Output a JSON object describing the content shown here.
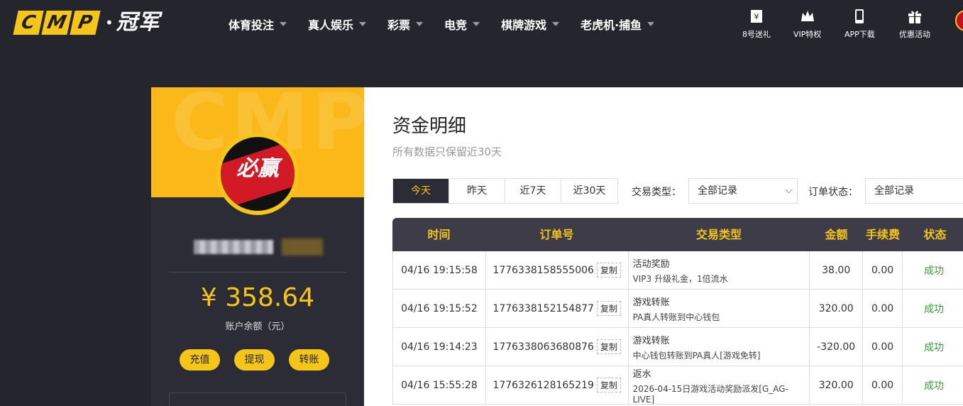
{
  "header": {
    "logo_letters": [
      "C",
      "M",
      "P"
    ],
    "logo_cn": "冠军",
    "nav": [
      {
        "label": "体育投注"
      },
      {
        "label": "真人娱乐"
      },
      {
        "label": "彩票"
      },
      {
        "label": "电竞"
      },
      {
        "label": "棋牌游戏"
      },
      {
        "label": "老虎机·捕鱼"
      }
    ],
    "quick_links": [
      {
        "label": "8号送礼",
        "icon": "gift-box-icon"
      },
      {
        "label": "VIP特权",
        "icon": "crown-icon"
      },
      {
        "label": "APP下载",
        "icon": "phone-icon"
      },
      {
        "label": "优惠活动",
        "icon": "present-icon"
      }
    ]
  },
  "profile": {
    "bg_text": "CMP",
    "avatar_text": "必赢",
    "balance": "¥ 358.64",
    "balance_label": "账户余额（元）",
    "buttons": {
      "deposit": "充值",
      "withdraw": "提现",
      "transfer": "转账"
    }
  },
  "main": {
    "title": "资金明细",
    "subtitle": "所有数据只保留近30天",
    "tabs": [
      {
        "label": "今天",
        "active": true
      },
      {
        "label": "昨天",
        "active": false
      },
      {
        "label": "近7天",
        "active": false
      },
      {
        "label": "近30天",
        "active": false
      }
    ],
    "filters": {
      "type_label": "交易类型：",
      "type_value": "全部记录",
      "status_label": "订单状态：",
      "status_value": "全部记录"
    },
    "table": {
      "headers": [
        "时间",
        "订单号",
        "交易类型",
        "金额",
        "手续费",
        "状态"
      ],
      "copy_label": "复制",
      "rows": [
        {
          "time": "04/16 19:15:58",
          "order": "1776338158555006",
          "type": "活动奖励",
          "desc": "VIP3 升级礼金，1倍流水",
          "amount": "38.00",
          "fee": "0.00",
          "status": "成功"
        },
        {
          "time": "04/16 19:15:52",
          "order": "1776338152154877",
          "type": "游戏转账",
          "desc": "PA真人转账到中心钱包",
          "amount": "320.00",
          "fee": "0.00",
          "status": "成功"
        },
        {
          "time": "04/16 19:14:23",
          "order": "1776338063680876",
          "type": "游戏转账",
          "desc": "中心钱包转账到PA真人[游戏免转]",
          "amount": "-320.00",
          "fee": "0.00",
          "status": "成功"
        },
        {
          "time": "04/16 15:55:28",
          "order": "1776326128165219",
          "type": "返水",
          "desc": "2026-04-15日游戏活动奖励派发[G_AG-LIVE]",
          "amount": "320.00",
          "fee": "0.00",
          "status": "成功"
        }
      ]
    }
  },
  "colors": {
    "accent": "#f5c518",
    "dark": "#25252e",
    "success": "#3a9a3a"
  }
}
